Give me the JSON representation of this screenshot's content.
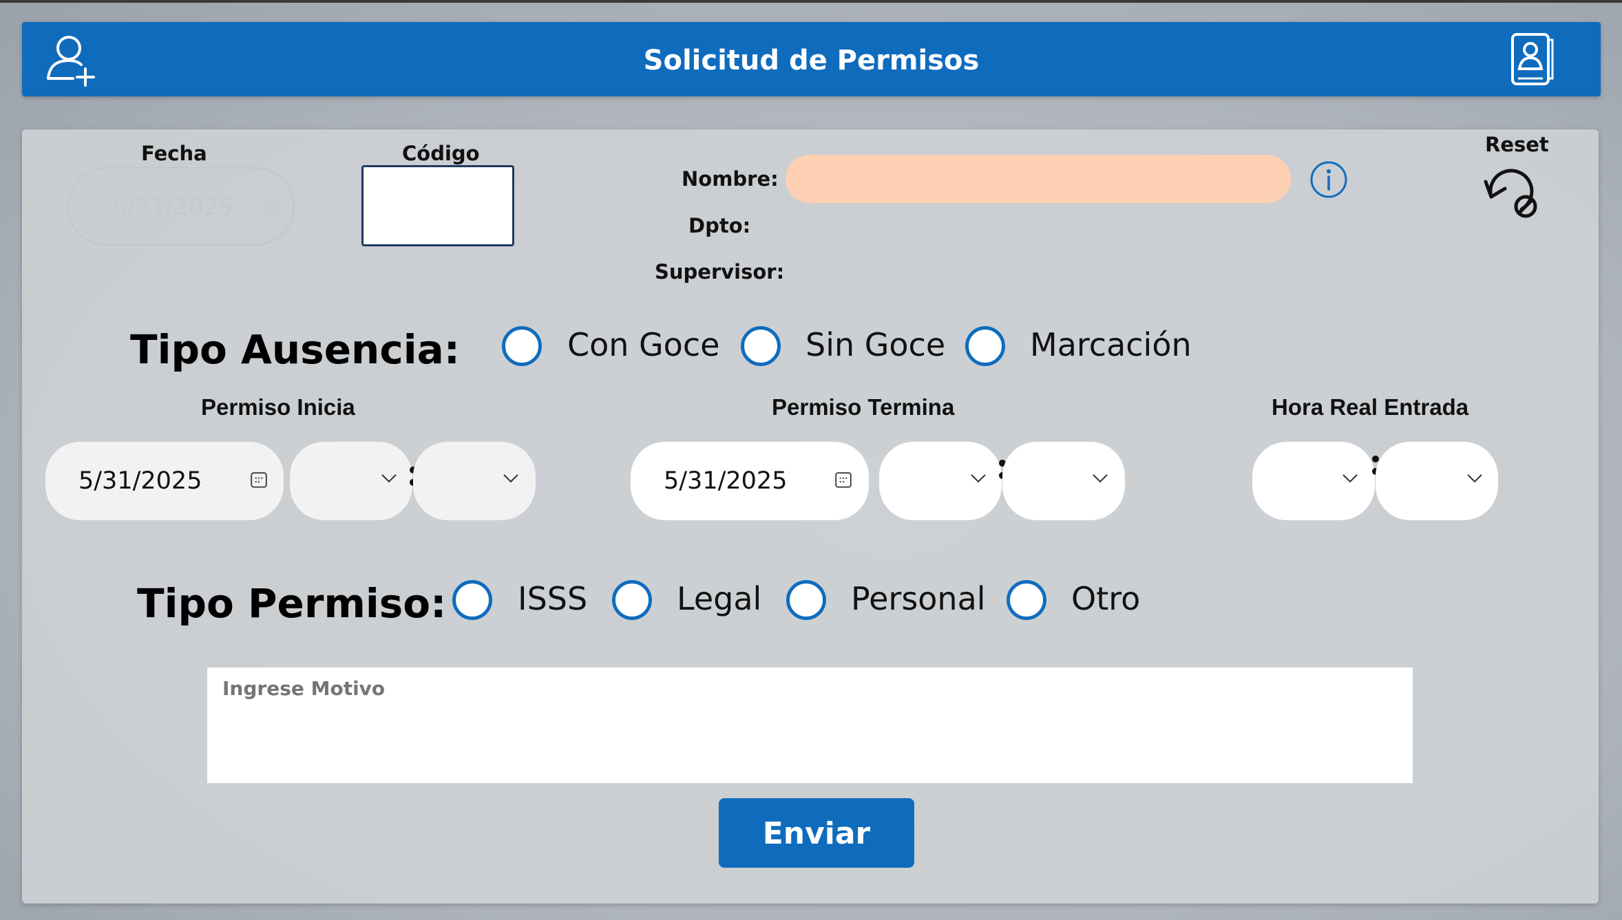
{
  "header": {
    "title": "Solicitud de Permisos",
    "left_icon": "add-user-icon",
    "right_icon": "contact-book-icon"
  },
  "top": {
    "fecha_label": "Fecha",
    "fecha_value": "5/31/2025",
    "codigo_label": "Código",
    "codigo_value": "",
    "nombre_label": "Nombre:",
    "nombre_value": "",
    "dpto_label": "Dpto:",
    "supervisor_label": "Supervisor:",
    "reset_label": "Reset",
    "info_icon": "info-icon",
    "reset_icon": "reset-icon"
  },
  "ausencia": {
    "label": "Tipo Ausencia:",
    "options": [
      "Con Goce",
      "Sin Goce",
      "Marcación"
    ]
  },
  "permiso_inicia": {
    "label": "Permiso Inicia",
    "date": "5/31/2025",
    "hour": "",
    "minute": ""
  },
  "permiso_termina": {
    "label": "Permiso Termina",
    "date": "5/31/2025",
    "hour": "",
    "minute": ""
  },
  "hora_real": {
    "label": "Hora Real Entrada",
    "hour": "",
    "minute": ""
  },
  "permiso": {
    "label": "Tipo Permiso:",
    "options": [
      "ISSS",
      "Legal",
      "Personal",
      "Otro"
    ]
  },
  "motivo": {
    "placeholder": "Ingrese Motivo",
    "value": ""
  },
  "submit": {
    "label": "Enviar"
  },
  "colors": {
    "accent": "#0f6cbd",
    "name_field": "#fdd0b4",
    "card": "#cdd0d4"
  }
}
